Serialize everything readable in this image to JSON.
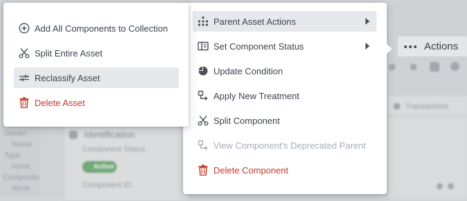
{
  "background": {
    "section_title": "Identification",
    "component_status_label": "Component Status",
    "status_badge": "Active",
    "component_id_label": "Component ID",
    "transactions_tab": "Transactions",
    "side_labels": [
      "Owner",
      "Name",
      "Type",
      "None",
      "Composite",
      "None"
    ]
  },
  "actions_button": {
    "label": "Actions"
  },
  "main_menu": {
    "items": [
      {
        "label": "Parent Asset Actions",
        "icon": "hierarchy-icon"
      },
      {
        "label": "Set Component Status",
        "icon": "status-card-icon"
      },
      {
        "label": "Update Condition",
        "icon": "pie-chart-icon"
      },
      {
        "label": "Apply New Treatment",
        "icon": "treatment-icon"
      },
      {
        "label": "Split Component",
        "icon": "scissors-icon"
      },
      {
        "label": "View Component's Deprecated Parent",
        "icon": "deprecated-parent-icon"
      },
      {
        "label": "Delete Component",
        "icon": "trash-icon"
      }
    ]
  },
  "sub_menu": {
    "items": [
      {
        "label": "Add All Components to Collection",
        "icon": "plus-circle-icon"
      },
      {
        "label": "Split Entire Asset",
        "icon": "scissors-icon"
      },
      {
        "label": "Reclassify Asset",
        "icon": "reclassify-icon"
      },
      {
        "label": "Delete Asset",
        "icon": "trash-icon"
      }
    ]
  },
  "colors": {
    "danger": "#c0392b",
    "highlight": "#e6e8eb",
    "text": "#3c434c",
    "disabled": "#a6acb3"
  }
}
